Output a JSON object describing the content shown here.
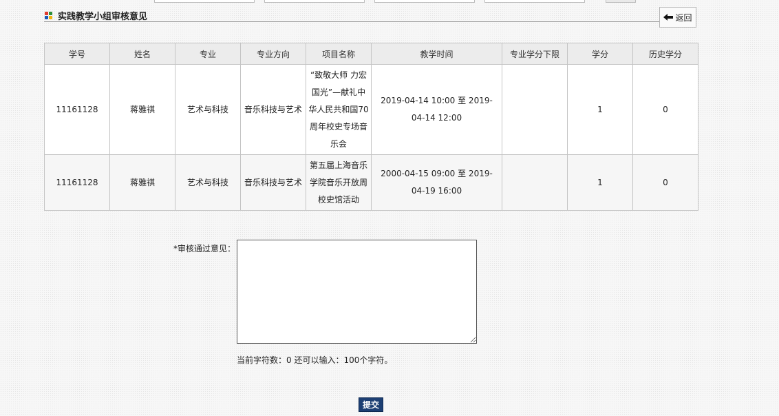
{
  "section": {
    "title": "实践教学小组审核意见"
  },
  "back_button": {
    "label": "返回"
  },
  "table": {
    "headers": [
      "学号",
      "姓名",
      "专业",
      "专业方向",
      "项目名称",
      "教学时间",
      "专业学分下限",
      "学分",
      "历史学分"
    ],
    "rows": [
      {
        "student_id": "11161128",
        "name": "蒋雅祺",
        "major": "艺术与科技",
        "direction": "音乐科技与艺术",
        "project": "“致敬大师 力宏国光”—献礼中华人民共和国70周年校史专场音乐会",
        "time": "2019-04-14 10:00 至 2019-04-14 12:00",
        "min_credit": "",
        "credit": "1",
        "history_credit": "0"
      },
      {
        "student_id": "11161128",
        "name": "蒋雅祺",
        "major": "艺术与科技",
        "direction": "音乐科技与艺术",
        "project": "第五届上海音乐学院音乐开放周校史馆活动",
        "time": "2000-04-15 09:00 至 2019-04-19 16:00",
        "min_credit": "",
        "credit": "1",
        "history_credit": "0"
      }
    ]
  },
  "form": {
    "opinion_label": "*审核通过意见：",
    "opinion_value": "",
    "counter_text": "当前字符数：0 还可以输入：100个字符。",
    "submit_label": "提交"
  }
}
